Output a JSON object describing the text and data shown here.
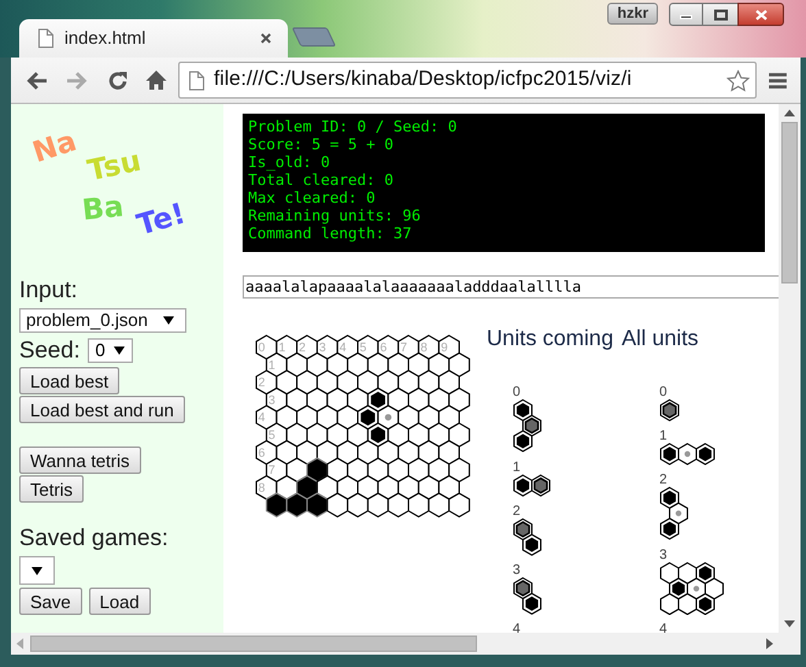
{
  "window": {
    "user_badge": "hzkr"
  },
  "tabs": [
    {
      "title": "index.html",
      "selected": true
    }
  ],
  "nav": [
    {
      "kind": "back",
      "disabled": false
    },
    {
      "kind": "forward",
      "disabled": true
    },
    {
      "kind": "reload",
      "disabled": false
    },
    {
      "kind": "home",
      "disabled": false
    }
  ],
  "address": "file:///C:/Users/kinaba/Desktop/icfpc2015/viz/i",
  "sidebar": {
    "logo": [
      {
        "text": "Na",
        "color": "#ff9966"
      },
      {
        "text": "Tsu",
        "color": "#c8dc32"
      },
      {
        "text": "Ba",
        "color": "#77dd55"
      },
      {
        "text": "Te!",
        "color": "#5555ff"
      }
    ],
    "input_label": "Input:",
    "problem": "problem_0.json",
    "seed_label": "Seed:",
    "seed": "0",
    "load_buttons": [
      "Load best",
      "Load best and run"
    ],
    "tetris_buttons": [
      "Wanna tetris",
      "Tetris"
    ],
    "saved_label": "Saved games:",
    "saved_buttons": [
      "Save",
      "Load"
    ]
  },
  "status": [
    "Problem ID: 0 / Seed: 0",
    "Score: 5 = 5 + 0",
    "Is_old: 0",
    "Total cleared: 0",
    "Max cleared: 0",
    "Remaining units: 96",
    "Command length: 37"
  ],
  "command": "aaaalalapaaaalalaaaaaaaladddaalalllla",
  "board": {
    "column_labels": [
      "0",
      "1",
      "2",
      "3",
      "4",
      "5",
      "6",
      "7",
      "8",
      "9"
    ],
    "rows": [
      {
        "cells": [
          {
            "kind": "empty"
          },
          {
            "kind": "empty"
          },
          {
            "kind": "empty"
          },
          {
            "kind": "empty"
          },
          {
            "kind": "empty"
          },
          {
            "kind": "empty"
          },
          {
            "kind": "empty"
          },
          {
            "kind": "empty"
          },
          {
            "kind": "empty"
          },
          {
            "kind": "empty"
          }
        ]
      },
      {
        "label": "1",
        "cells": [
          {
            "kind": "empty"
          },
          {
            "kind": "empty"
          },
          {
            "kind": "empty"
          },
          {
            "kind": "empty"
          },
          {
            "kind": "empty"
          },
          {
            "kind": "empty"
          },
          {
            "kind": "empty"
          },
          {
            "kind": "empty"
          },
          {
            "kind": "empty"
          },
          {
            "kind": "empty"
          }
        ]
      },
      {
        "label": "2",
        "cells": [
          {
            "kind": "empty"
          },
          {
            "kind": "empty"
          },
          {
            "kind": "empty"
          },
          {
            "kind": "empty"
          },
          {
            "kind": "empty"
          },
          {
            "kind": "empty"
          },
          {
            "kind": "empty"
          },
          {
            "kind": "empty"
          },
          {
            "kind": "empty"
          },
          {
            "kind": "empty"
          }
        ]
      },
      {
        "label": "3",
        "cells": [
          {
            "kind": "empty"
          },
          {
            "kind": "empty"
          },
          {
            "kind": "empty"
          },
          {
            "kind": "empty"
          },
          {
            "kind": "empty"
          },
          {
            "kind": "unit"
          },
          {
            "kind": "empty"
          },
          {
            "kind": "empty"
          },
          {
            "kind": "empty"
          },
          {
            "kind": "empty"
          }
        ]
      },
      {
        "label": "4",
        "cells": [
          {
            "kind": "empty"
          },
          {
            "kind": "empty"
          },
          {
            "kind": "empty"
          },
          {
            "kind": "empty"
          },
          {
            "kind": "empty"
          },
          {
            "kind": "unit"
          },
          {
            "kind": "pivot"
          },
          {
            "kind": "empty"
          },
          {
            "kind": "empty"
          },
          {
            "kind": "empty"
          }
        ]
      },
      {
        "label": "5",
        "cells": [
          {
            "kind": "empty"
          },
          {
            "kind": "empty"
          },
          {
            "kind": "empty"
          },
          {
            "kind": "empty"
          },
          {
            "kind": "empty"
          },
          {
            "kind": "unit"
          },
          {
            "kind": "empty"
          },
          {
            "kind": "empty"
          },
          {
            "kind": "empty"
          },
          {
            "kind": "empty"
          }
        ]
      },
      {
        "label": "6",
        "cells": [
          {
            "kind": "empty"
          },
          {
            "kind": "empty"
          },
          {
            "kind": "empty"
          },
          {
            "kind": "empty"
          },
          {
            "kind": "empty"
          },
          {
            "kind": "empty"
          },
          {
            "kind": "empty"
          },
          {
            "kind": "empty"
          },
          {
            "kind": "empty"
          },
          {
            "kind": "empty"
          }
        ]
      },
      {
        "label": "7",
        "cells": [
          {
            "kind": "empty"
          },
          {
            "kind": "empty"
          },
          {
            "kind": "filled"
          },
          {
            "kind": "empty"
          },
          {
            "kind": "empty"
          },
          {
            "kind": "empty"
          },
          {
            "kind": "empty"
          },
          {
            "kind": "empty"
          },
          {
            "kind": "empty"
          },
          {
            "kind": "empty"
          }
        ]
      },
      {
        "label": "8",
        "cells": [
          {
            "kind": "empty"
          },
          {
            "kind": "empty"
          },
          {
            "kind": "filled"
          },
          {
            "kind": "empty"
          },
          {
            "kind": "empty"
          },
          {
            "kind": "empty"
          },
          {
            "kind": "empty"
          },
          {
            "kind": "empty"
          },
          {
            "kind": "empty"
          },
          {
            "kind": "empty"
          }
        ]
      },
      {
        "cells": [
          {
            "kind": "filled"
          },
          {
            "kind": "filled"
          },
          {
            "kind": "filled"
          },
          {
            "kind": "empty"
          },
          {
            "kind": "empty"
          },
          {
            "kind": "empty"
          },
          {
            "kind": "empty"
          },
          {
            "kind": "empty"
          },
          {
            "kind": "empty"
          },
          {
            "kind": "empty"
          }
        ]
      }
    ]
  },
  "units_coming": {
    "heading": "Units coming",
    "units": [
      {
        "label": "0",
        "rows": [
          [
            {
              "kind": "unit"
            }
          ],
          [
            {
              "kind": "unit-pivot"
            }
          ],
          [
            {
              "kind": "unit"
            }
          ]
        ]
      },
      {
        "label": "1",
        "rows": [
          [
            {
              "kind": "unit"
            },
            {
              "kind": "unit-pivot"
            }
          ]
        ]
      },
      {
        "label": "2",
        "rows": [
          [
            {
              "kind": "unit-pivot"
            }
          ],
          [
            {
              "kind": "unit"
            }
          ]
        ]
      },
      {
        "label": "3",
        "rows": [
          [
            {
              "kind": "unit-pivot"
            }
          ],
          [
            {
              "kind": "unit"
            }
          ]
        ]
      },
      {
        "label": "4"
      }
    ]
  },
  "all_units": {
    "heading": "All units",
    "units": [
      {
        "label": "0",
        "rows": [
          [
            {
              "kind": "unit-pivot"
            }
          ]
        ]
      },
      {
        "label": "1",
        "rows": [
          [
            {
              "kind": "unit"
            },
            {
              "kind": "pivot"
            },
            {
              "kind": "unit"
            }
          ]
        ]
      },
      {
        "label": "2",
        "rows": [
          [
            {
              "kind": "unit"
            }
          ],
          [
            {
              "kind": "pivot"
            }
          ],
          [
            {
              "kind": "unit"
            }
          ]
        ]
      },
      {
        "label": "3",
        "rows": [
          [
            {
              "kind": "empty"
            },
            {
              "kind": "empty"
            },
            {
              "kind": "unit"
            }
          ],
          [
            {
              "kind": "unit"
            },
            {
              "kind": "pivot"
            },
            {
              "kind": "empty"
            }
          ],
          [
            {
              "kind": "empty"
            },
            {
              "kind": "empty"
            },
            {
              "kind": "unit"
            }
          ]
        ]
      },
      {
        "label": "4"
      }
    ]
  }
}
